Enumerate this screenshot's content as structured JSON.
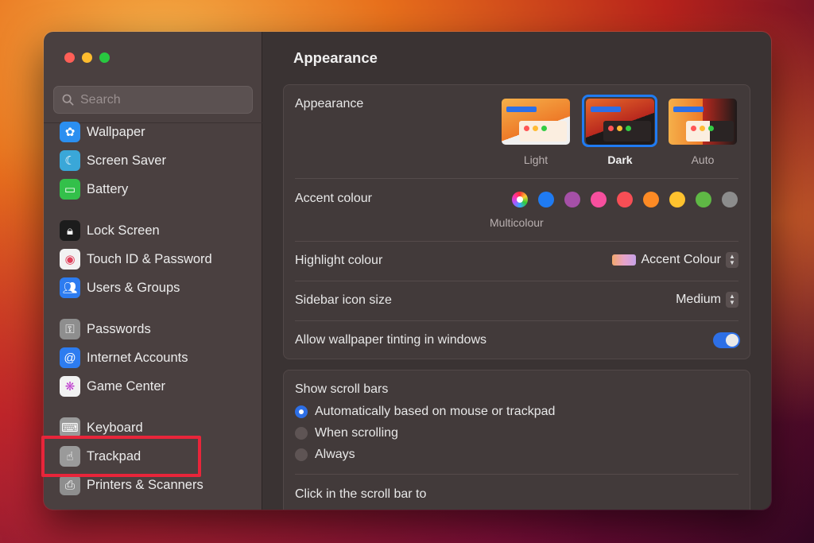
{
  "sidebar": {
    "search_placeholder": "Search",
    "items": [
      {
        "label": "Wallpaper",
        "icon": "wallpaper-icon",
        "color": "#2b8ff0"
      },
      {
        "label": "Screen Saver",
        "icon": "screen-saver-icon",
        "color": "#3aa7d8"
      },
      {
        "label": "Battery",
        "icon": "battery-icon",
        "color": "#33c04a"
      },
      {
        "label": "Lock Screen",
        "icon": "lock-icon",
        "color": "#1c1c1c"
      },
      {
        "label": "Touch ID & Password",
        "icon": "fingerprint-icon",
        "color": "#f2f2f2"
      },
      {
        "label": "Users & Groups",
        "icon": "users-icon",
        "color": "#2d7cf0"
      },
      {
        "label": "Passwords",
        "icon": "key-icon",
        "color": "#8e8e8e"
      },
      {
        "label": "Internet Accounts",
        "icon": "at-icon",
        "color": "#2d7cf0"
      },
      {
        "label": "Game Center",
        "icon": "game-center-icon",
        "color": "#f2f2f2"
      },
      {
        "label": "Keyboard",
        "icon": "keyboard-icon",
        "color": "#9a9a9a"
      },
      {
        "label": "Trackpad",
        "icon": "trackpad-icon",
        "color": "#9a9a9a"
      },
      {
        "label": "Printers & Scanners",
        "icon": "printer-icon",
        "color": "#8e8e8e"
      }
    ]
  },
  "main": {
    "title": "Appearance",
    "appearance": {
      "label": "Appearance",
      "options": [
        {
          "label": "Light",
          "selected": false
        },
        {
          "label": "Dark",
          "selected": true
        },
        {
          "label": "Auto",
          "selected": false
        }
      ]
    },
    "accent": {
      "label": "Accent colour",
      "caption": "Multicolour",
      "colors": [
        "multicolour",
        "#1f7bf2",
        "#a550a7",
        "#f74f9e",
        "#f74e55",
        "#fd8a24",
        "#fec22e",
        "#5fb845",
        "#8c8c8c"
      ]
    },
    "highlight": {
      "label": "Highlight colour",
      "value": "Accent Colour"
    },
    "sidebar_icon_size": {
      "label": "Sidebar icon size",
      "value": "Medium"
    },
    "wallpaper_tinting": {
      "label": "Allow wallpaper tinting in windows",
      "enabled": true
    },
    "scroll_bars": {
      "label": "Show scroll bars",
      "options": [
        {
          "label": "Automatically based on mouse or trackpad",
          "selected": true
        },
        {
          "label": "When scrolling",
          "selected": false
        },
        {
          "label": "Always",
          "selected": false
        }
      ]
    },
    "click_scroll": {
      "label": "Click in the scroll bar to"
    }
  },
  "colors": {
    "accent_blue": "#1f7bf2",
    "highlight_red": "#e8253a"
  }
}
